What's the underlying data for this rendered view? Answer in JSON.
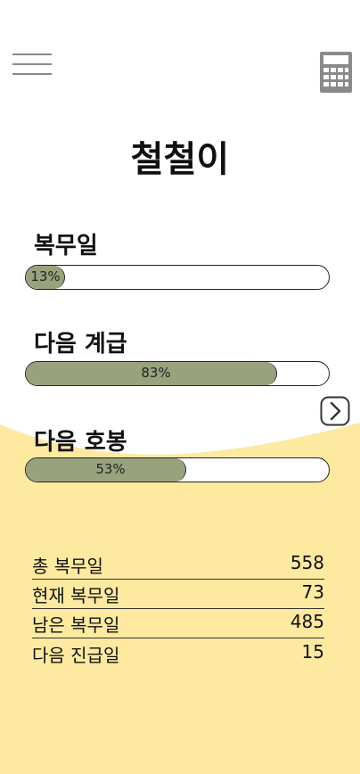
{
  "header": {
    "menu_icon": "hamburger-menu-icon",
    "calculator_icon": "calculator-icon"
  },
  "title": "철철이",
  "progress": [
    {
      "label": "복무일",
      "percent_text": "13%",
      "fraction": 0.13
    },
    {
      "label": "다음 계급",
      "percent_text": "83%",
      "fraction": 0.83
    },
    {
      "label": "다음 호봉",
      "percent_text": "53%",
      "fraction": 0.53
    }
  ],
  "next_icon": "chevron-right-icon",
  "stats": [
    {
      "label": "총 복무일",
      "value": "558"
    },
    {
      "label": "현재 복무일",
      "value": "73"
    },
    {
      "label": "남은 복무일",
      "value": "485"
    },
    {
      "label": "다음 진급일",
      "value": "15"
    }
  ],
  "colors": {
    "bar_fill": "#98a37d",
    "background_wave": "#fde9a0",
    "icon_gray": "#8a8a8a"
  }
}
